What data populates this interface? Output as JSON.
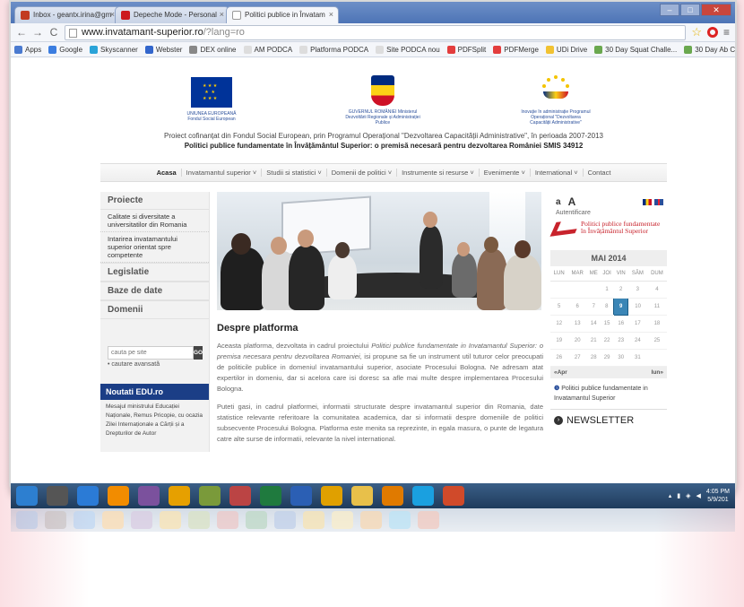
{
  "browser": {
    "tabs": [
      {
        "label": "Inbox - geantx.irina@gm",
        "color": "#c23b22"
      },
      {
        "label": "Depeche Mode - Personal",
        "color": "#cc181e"
      },
      {
        "label": "Politici publice in Învatam",
        "color": "#ffffff"
      }
    ],
    "url_host": "www.invatamant-superior.ro",
    "url_path": "/?lang=ro",
    "bookmarks": [
      {
        "label": "Apps",
        "color": "#4a7ad0"
      },
      {
        "label": "Google",
        "color": "#3b7de0"
      },
      {
        "label": "Skyscanner",
        "color": "#2aa3d8"
      },
      {
        "label": "Webster",
        "color": "#3366cc"
      },
      {
        "label": "DEX online",
        "color": "#888888"
      },
      {
        "label": "AM PODCA",
        "color": "#dddddd"
      },
      {
        "label": "Platforma PODCA",
        "color": "#dddddd"
      },
      {
        "label": "Site PODCA nou",
        "color": "#dddddd"
      },
      {
        "label": "PDFSplit",
        "color": "#e33d3d"
      },
      {
        "label": "PDFMerge",
        "color": "#e33d3d"
      },
      {
        "label": "UDi Drive",
        "color": "#f1c232"
      },
      {
        "label": "30 Day Squat Challe...",
        "color": "#6aa84f"
      },
      {
        "label": "30 Day Ab Challenge",
        "color": "#6aa84f"
      }
    ]
  },
  "header": {
    "logo_eu": "UNIUNEA EUROPEANĂ Fondul Social European",
    "logo_gov": "GUVERNUL ROMÂNIEI Ministerul Dezvoltării Regionale și Administrației Publice",
    "logo_admin": "Inovație în administrație Programul Operațional \"Dezvoltarea Capacității Administrative\"",
    "project_line": "Proiect cofinanțat din Fondul Social European, prin Programul Operațional \"Dezvoltarea Capacității Administrative\", în perioada 2007-2013",
    "project_title": "Politici publice fundamentate în Învățământul Superior: o premisă necesară pentru dezvoltarea României SMIS 34912"
  },
  "nav": [
    "Acasa",
    "Invatamantul superior ˅",
    "Studii si statistici ˅",
    "Domenii de politici ˅",
    "Instrumente si resurse ˅",
    "Evenimente ˅",
    "International ˅",
    "Contact"
  ],
  "sidebar": {
    "projects_title": "Proiecte",
    "projects": [
      "Calitate si diversitate a universitatilor din Romania",
      "Intarirea invatamantului superior orientat spre competente"
    ],
    "sections": [
      "Legislatie",
      "Baze de date",
      "Domenii"
    ],
    "search_placeholder": "cauta pe site",
    "search_button": "GO",
    "advanced_search": "• cautare avansată",
    "news_title": "Noutati EDU.ro",
    "news_text": "Mesajul ministrului Educației Naționale, Remus Pricopie, cu ocazia Zilei Internaționale a Cărții și a Drepturilor de Autor"
  },
  "main": {
    "about_title": "Despre platforma",
    "p1_a": "Aceasta platforma, dezvoltata in cadrul proiectului ",
    "p1_i": "Politici publice fundamentate in Invatamantul Superior: o premisa necesara pentru dezvoltarea Romaniei",
    "p1_b": ", isi propune sa fie un instrument util tuturor celor preocupati de politicile publice in domeniul invatamantului superior, asociate Procesului Bologna. Ne adresam atat expertilor in domeniu, dar si acelora care isi doresc sa afle mai multe despre implementarea Procesului Bologna.",
    "p2": "Puteti gasi, in cadrul platformei, informatii structurate despre invatamantul superior din Romania, date statistice relevante referitoare la comunitatea academica, dar si informatii despre domeniile de politici subsecvente Procesului Bologna. Platforma este menita sa reprezinte, in egala masura, o punte de legatura catre alte surse de informatii, relevante la nivel international."
  },
  "right": {
    "font_small": "a",
    "font_large": "A",
    "auth": "Autentificare",
    "brand_line1": "Politici publice fundamentate",
    "brand_line2": "în Învățământul Superior",
    "calendar_title": "MAI 2014",
    "weekdays": [
      "LUN",
      "MAR",
      "ME",
      "JOI",
      "VIN",
      "SÂM",
      "DUM"
    ],
    "weeks": [
      [
        "",
        "",
        "",
        "1",
        "2",
        "3",
        "4"
      ],
      [
        "5",
        "6",
        "7",
        "8",
        "9",
        "10",
        "11"
      ],
      [
        "12",
        "13",
        "14",
        "15",
        "16",
        "17",
        "18"
      ],
      [
        "19",
        "20",
        "21",
        "22",
        "23",
        "24",
        "25"
      ],
      [
        "26",
        "27",
        "28",
        "29",
        "30",
        "31",
        ""
      ]
    ],
    "today": "9",
    "prev": "«Apr",
    "next": "Iun»",
    "pp_text": "Politici publice fundamentate in Invatamantul Superior",
    "newsletter": "NEWSLETTER"
  },
  "taskbar": {
    "apps": [
      {
        "name": "start-orb-icon",
        "color": "#2d7fd0"
      },
      {
        "name": "pen-icon",
        "color": "#555555"
      },
      {
        "name": "internet-explorer-icon",
        "color": "#2b7bd6"
      },
      {
        "name": "vlc-icon",
        "color": "#f28c00"
      },
      {
        "name": "viber-icon",
        "color": "#7b519d"
      },
      {
        "name": "user-icon",
        "color": "#e6a000"
      },
      {
        "name": "paint-icon",
        "color": "#7a9a3a"
      },
      {
        "name": "media-icon",
        "color": "#b44"
      },
      {
        "name": "excel-icon",
        "color": "#1f7a3e"
      },
      {
        "name": "word-icon",
        "color": "#2b5fb4"
      },
      {
        "name": "chrome-icon",
        "color": "#e0a000"
      },
      {
        "name": "explorer-icon",
        "color": "#e8c04a"
      },
      {
        "name": "outlook-icon",
        "color": "#e07a00"
      },
      {
        "name": "skype-icon",
        "color": "#1aa0e0"
      },
      {
        "name": "powerpoint-icon",
        "color": "#d04a2a"
      }
    ],
    "time": "4:05 PM",
    "date": "5/9/201"
  }
}
